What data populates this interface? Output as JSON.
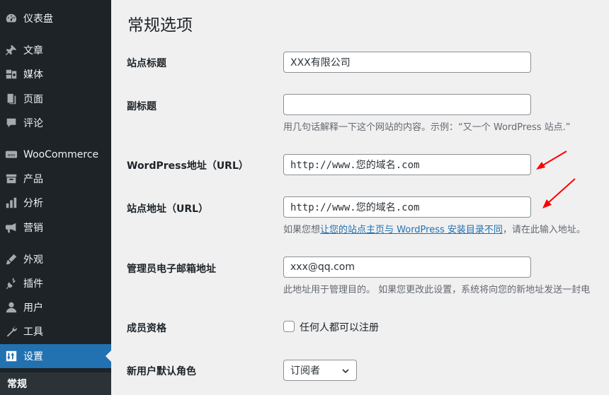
{
  "sidebar": {
    "items": [
      {
        "label": "仪表盘",
        "icon": "dashboard-icon"
      },
      {
        "label": "文章",
        "icon": "pushpin-icon"
      },
      {
        "label": "媒体",
        "icon": "media-icon"
      },
      {
        "label": "页面",
        "icon": "page-icon"
      },
      {
        "label": "评论",
        "icon": "comment-icon"
      },
      {
        "label": "WooCommerce",
        "icon": "woocommerce-icon"
      },
      {
        "label": "产品",
        "icon": "archive-icon"
      },
      {
        "label": "分析",
        "icon": "bar-chart-icon"
      },
      {
        "label": "营销",
        "icon": "megaphone-icon"
      },
      {
        "label": "外观",
        "icon": "paintbrush-icon"
      },
      {
        "label": "插件",
        "icon": "plugin-icon"
      },
      {
        "label": "用户",
        "icon": "user-icon"
      },
      {
        "label": "工具",
        "icon": "wrench-icon"
      },
      {
        "label": "设置",
        "icon": "settings-icon"
      }
    ],
    "current_submenu": "常规"
  },
  "page": {
    "title": "常规选项",
    "fields": {
      "site_title": {
        "label": "站点标题",
        "value": "XXX有限公司"
      },
      "tagline": {
        "label": "副标题",
        "value": "",
        "description": "用几句话解释一下这个网站的内容。示例：“又一个 WordPress 站点.”"
      },
      "wp_url": {
        "label": "WordPress地址（URL）",
        "value": "http://www.您的域名.com"
      },
      "site_url": {
        "label": "站点地址（URL）",
        "value": "http://www.您的域名.com",
        "desc_prefix": "如果您想",
        "desc_link": "让您的站点主页与 WordPress 安装目录不同",
        "desc_suffix": "，请在此输入地址。"
      },
      "admin_email": {
        "label": "管理员电子邮箱地址",
        "value": "xxx@qq.com",
        "description": "此地址用于管理目的。 如果您更改此设置，系统将向您的新地址发送一封电"
      },
      "membership": {
        "label": "成员资格",
        "checkbox_label": "任何人都可以注册",
        "checked": false
      },
      "default_role": {
        "label": "新用户默认角色",
        "selected": "订阅者"
      }
    }
  },
  "colors": {
    "accent": "#2271b1",
    "sidebar_bg": "#1d2327",
    "annotation_arrow": "#ff0000"
  }
}
